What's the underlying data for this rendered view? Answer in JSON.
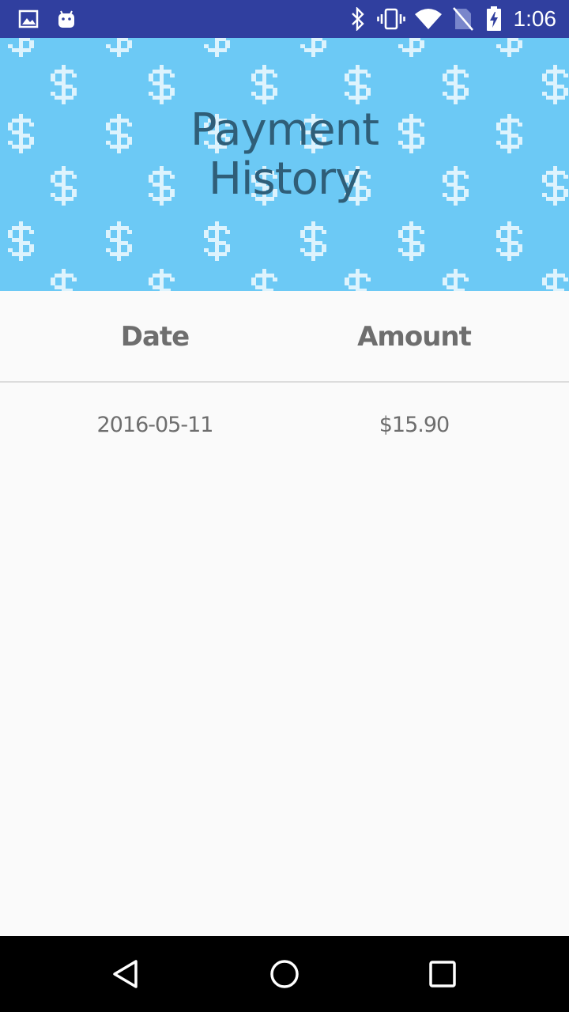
{
  "status_bar": {
    "time": "1:06",
    "left_icons": [
      "image-icon",
      "android-icon"
    ],
    "right_icons": [
      "bluetooth-icon",
      "vibrate-icon",
      "wifi-icon",
      "no-sim-icon",
      "battery-charging-icon"
    ]
  },
  "header": {
    "title_line1": "Payment",
    "title_line2": "History",
    "background_color": "#6cc9f5",
    "pattern_icon": "dollar-sign-icon"
  },
  "table": {
    "columns": [
      "Date",
      "Amount"
    ],
    "rows": [
      {
        "date": "2016-05-11",
        "amount": "$15.90"
      }
    ]
  },
  "nav_bar": {
    "buttons": [
      "back-icon",
      "home-icon",
      "recents-icon"
    ]
  },
  "colors": {
    "status_bar": "#303f9f",
    "title_text": "#2f5e78",
    "table_text": "#6e6e6e",
    "divider": "#dcdcdc",
    "page_background": "#fafafa"
  }
}
